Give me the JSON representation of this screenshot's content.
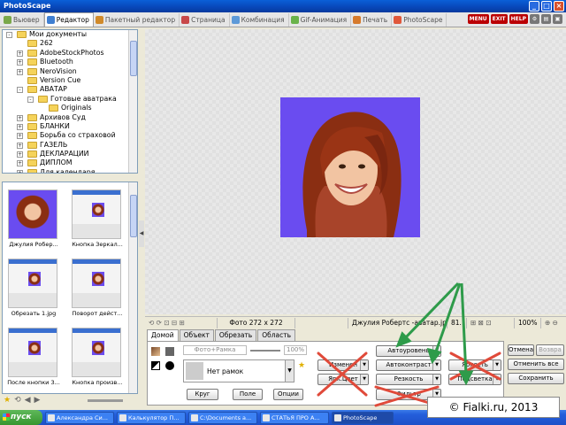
{
  "window": {
    "title": "PhotoScape"
  },
  "tabs": [
    {
      "label": "Вьювер",
      "color": "#7aa84a"
    },
    {
      "label": "Редактор",
      "color": "#3f7fd1"
    },
    {
      "label": "Пакетный редактор",
      "color": "#d08a2a"
    },
    {
      "label": "Страница",
      "color": "#c84848"
    },
    {
      "label": "Комбинация",
      "color": "#5d9ad8"
    },
    {
      "label": "Gif-Анимация",
      "color": "#6ab34a"
    },
    {
      "label": "Печать",
      "color": "#d67a2a"
    },
    {
      "label": "PhotoScape",
      "color": "#e0583a"
    }
  ],
  "top_buttons": [
    "MENU",
    "EXIT",
    "HELP"
  ],
  "tree": [
    {
      "label": "Мои документы",
      "level": 0,
      "exp": "-"
    },
    {
      "label": "262",
      "level": 1,
      "exp": ""
    },
    {
      "label": "AdobeStockPhotos",
      "level": 1,
      "exp": "+"
    },
    {
      "label": "Bluetooth",
      "level": 1,
      "exp": "+"
    },
    {
      "label": "NeroVision",
      "level": 1,
      "exp": "+"
    },
    {
      "label": "Version Cue",
      "level": 1,
      "exp": ""
    },
    {
      "label": "АВАТАР",
      "level": 1,
      "exp": "-"
    },
    {
      "label": "Готовые аватрака",
      "level": 2,
      "exp": "-"
    },
    {
      "label": "Originals",
      "level": 3,
      "exp": ""
    },
    {
      "label": "Архивов Суд",
      "level": 1,
      "exp": "+"
    },
    {
      "label": "БЛАНКИ",
      "level": 1,
      "exp": "+"
    },
    {
      "label": "Борьба со страховой",
      "level": 1,
      "exp": "+"
    },
    {
      "label": "ГАЗЕЛЬ",
      "level": 1,
      "exp": "+"
    },
    {
      "label": "ДЕКЛАРАЦИИ",
      "level": 1,
      "exp": "+"
    },
    {
      "label": "ДИПЛОМ",
      "level": 1,
      "exp": "+"
    },
    {
      "label": "Для календаря",
      "level": 1,
      "exp": "+"
    }
  ],
  "thumbnails": [
    {
      "caption": "Джулия Робер...",
      "kind": "portrait"
    },
    {
      "caption": "Кнопка Зеркал...",
      "kind": "screen"
    },
    {
      "caption": "Обрезать 1.jpg",
      "kind": "screen"
    },
    {
      "caption": "Поворот дейст...",
      "kind": "screen"
    },
    {
      "caption": "После кнопки 3...",
      "kind": "screen"
    },
    {
      "caption": "Кнопка произв...",
      "kind": "screen"
    }
  ],
  "status": {
    "photo_size": "Фото 272 x 272",
    "file_name": "Джулия Робертс -аватар.jpg",
    "file_size": "81.",
    "zoom": "100%"
  },
  "panel_tabs": [
    "Домой",
    "Объект",
    "Обрезать",
    "Область"
  ],
  "home": {
    "frame_input": "Фото+Рамка",
    "frame_value": "100%",
    "frame_select": "Нет рамок",
    "circle_button": "Круг",
    "field_button": "Поле",
    "options_button": "Опции",
    "auto_level": "Автоуровень",
    "auto_contrast": "Автоконтраст",
    "sharpness": "Резкость",
    "backlight": "Подсветка",
    "resize_crossed": "Изменен",
    "bright_crossed": "Ярк.Цвет",
    "filter_crossed": "Фильтр",
    "bloom_crossed": "Яркость"
  },
  "right_buttons": {
    "cancel": "Отмена",
    "redo": "Возвра",
    "cancel_all": "Отменить все",
    "save": "Сохранить"
  },
  "taskbar": {
    "start": "пуск",
    "tasks": [
      "Александра Си...",
      "Калькулятор П...",
      "C:\\Documents a...",
      "СТАТЬЯ ПРО А...",
      "PhotoScape"
    ]
  },
  "watermark": "© Fialki.ru, 2013",
  "colors": {
    "photo_bg": "#6a4cf0",
    "arrow": "#2e9b4a",
    "cross": "#e04a3a",
    "title": "#0846b8"
  }
}
